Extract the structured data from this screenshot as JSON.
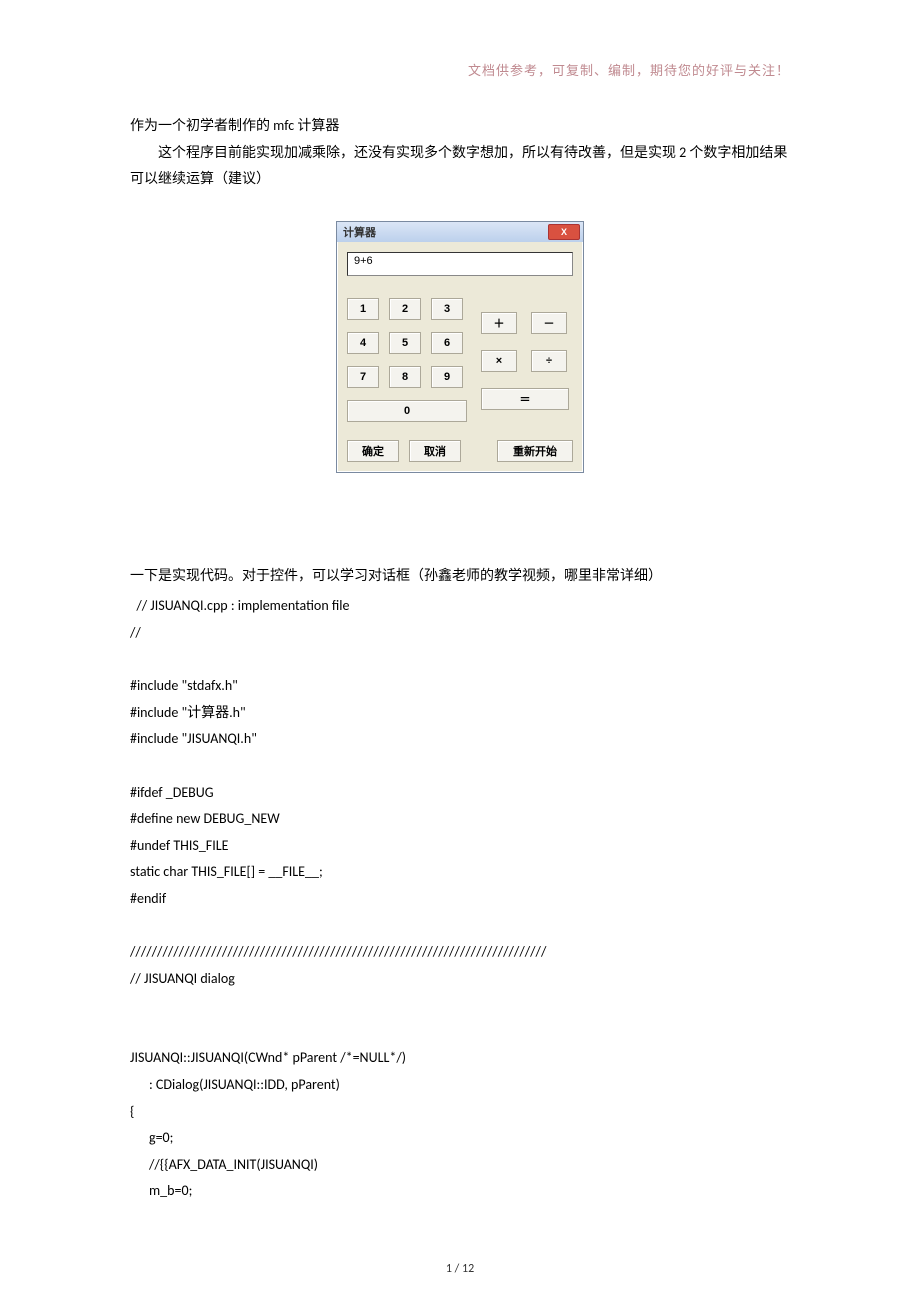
{
  "header_note": "文档供参考，可复制、编制，期待您的好评与关注！",
  "intro": {
    "line1": "作为一个初学者制作的 mfc 计算器",
    "line2": "这个程序目前能实现加减乘除，还没有实现多个数字想加，所以有待改善，但是实现 2 个数字相加结果可以继续运算（建议）"
  },
  "calc": {
    "title": "计算器",
    "close_x": "X",
    "display": "9+6",
    "keys": {
      "k1": "1",
      "k2": "2",
      "k3": "3",
      "k4": "4",
      "k5": "5",
      "k6": "6",
      "k7": "7",
      "k8": "8",
      "k9": "9",
      "k0": "0",
      "plus": "＋",
      "minus": "－",
      "times": "×",
      "div": "÷",
      "eq": "＝"
    },
    "ok": "确定",
    "cancel": "取消",
    "restart": "重新开始"
  },
  "para2": "一下是实现代码。对于控件，可以学习对话框（孙鑫老师的教学视频，哪里非常详细）",
  "code": {
    "l0": "  // JISUANQI.cpp : implementation file",
    "l1": "//",
    "l2": "",
    "l3": "#include \"stdafx.h\"",
    "l4": "#include \"计算器.h\"",
    "l5": "#include \"JISUANQI.h\"",
    "l6": "",
    "l7": "#ifdef _DEBUG",
    "l8": "#define new DEBUG_NEW",
    "l9": "#undef THIS_FILE",
    "l10": "static char THIS_FILE[] = __FILE__;",
    "l11": "#endif",
    "l12": "",
    "l13": "/////////////////////////////////////////////////////////////////////////////",
    "l14": "// JISUANQI dialog",
    "l15": "",
    "l16": "",
    "l17": "JISUANQI::JISUANQI(CWnd* pParent /*=NULL*/)",
    "l18": "      : CDialog(JISUANQI::IDD, pParent)",
    "l19": "{",
    "l20": "      g=0;",
    "l21": "      //{{AFX_DATA_INIT(JISUANQI)",
    "l22": "      m_b=0;"
  },
  "page_num": "1  / 12"
}
